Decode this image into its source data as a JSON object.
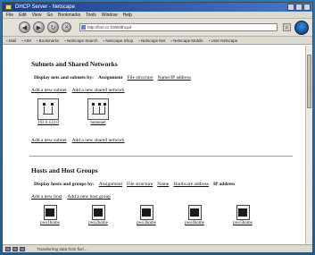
{
  "window": {
    "title": "DHCP Server - Netscape"
  },
  "menubar": {
    "items": [
      "File",
      "Edit",
      "View",
      "Go",
      "Bookmarks",
      "Tools",
      "Window",
      "Help"
    ]
  },
  "toolbar": {
    "url": "http://fiori.cc:1000/dhcpd"
  },
  "bookmarks": {
    "items": [
      "Mail",
      "AIM",
      "Bookmarks",
      "Netscape Search",
      "Netscape Shop",
      "Netscape Net",
      "Netscape Mobile",
      "User Netscape"
    ]
  },
  "statusbar": {
    "text": "Transferring data from fiori..."
  },
  "subnets": {
    "heading": "Subnets and Shared Networks",
    "display_label": "Display nets and subnets by:",
    "display_options": [
      "Assignment",
      "File structure",
      "Name/IP address"
    ],
    "current_option": "Assignment",
    "add_subnet": "Add a new subnet",
    "add_shared": "Add a new shared network",
    "items": [
      {
        "label": "192.0.122.0",
        "icon": "subnet-icon"
      },
      {
        "label": "homenet",
        "icon": "shared-network-icon"
      }
    ]
  },
  "hosts": {
    "heading": "Hosts and Host Groups",
    "display_label": "Display hosts and groups by:",
    "display_options": [
      "Assignment",
      "File structure",
      "Name",
      "Hardware address",
      "IP address"
    ],
    "current_option": "IP address",
    "add_host": "Add a new host",
    "add_group": "Add a new host group",
    "items": [
      {
        "label": "pws1home",
        "icon": "host-icon"
      },
      {
        "label": "pws2home",
        "icon": "host-icon"
      },
      {
        "label": "pws3home",
        "icon": "host-icon"
      },
      {
        "label": "pws4home",
        "icon": "host-icon"
      },
      {
        "label": "pws5home",
        "icon": "host-icon"
      }
    ]
  }
}
